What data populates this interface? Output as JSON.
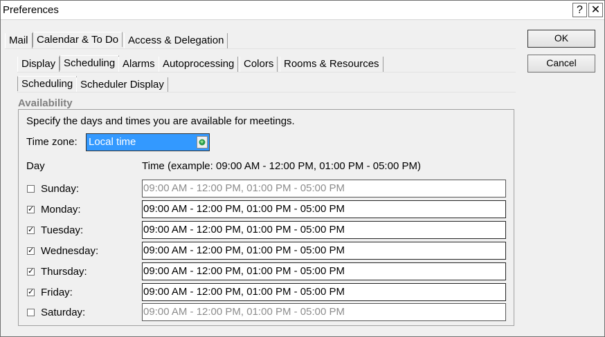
{
  "window": {
    "title": "Preferences",
    "help_glyph": "?",
    "close_glyph": "✕"
  },
  "tabs_main": [
    "Mail",
    "Calendar & To Do",
    "Access & Delegation"
  ],
  "tabs_calendar": [
    "Display",
    "Scheduling",
    "Alarms",
    "Autoprocessing",
    "Colors",
    "Rooms & Resources"
  ],
  "tabs_scheduling": [
    "Scheduling",
    "Scheduler Display"
  ],
  "buttons": {
    "ok": "OK",
    "cancel": "Cancel"
  },
  "availability": {
    "group_title": "Availability",
    "description": "Specify the days and times you are available for meetings.",
    "time_zone_label": "Time zone:",
    "time_zone_value": "Local time",
    "day_header": "Day",
    "time_header": "Time (example: 09:00 AM - 12:00 PM, 01:00 PM - 05:00 PM)",
    "days": [
      {
        "label": "Sunday:",
        "checked": false,
        "check_glyph": "",
        "value": "09:00 AM - 12:00 PM, 01:00 PM - 05:00 PM"
      },
      {
        "label": "Monday:",
        "checked": true,
        "check_glyph": "✓",
        "value": "09:00 AM - 12:00 PM, 01:00 PM - 05:00 PM"
      },
      {
        "label": "Tuesday:",
        "checked": true,
        "check_glyph": "✓",
        "value": "09:00 AM - 12:00 PM, 01:00 PM - 05:00 PM"
      },
      {
        "label": "Wednesday:",
        "checked": true,
        "check_glyph": "✓",
        "value": "09:00 AM - 12:00 PM, 01:00 PM - 05:00 PM"
      },
      {
        "label": "Thursday:",
        "checked": true,
        "check_glyph": "✓",
        "value": "09:00 AM - 12:00 PM, 01:00 PM - 05:00 PM"
      },
      {
        "label": "Friday:",
        "checked": true,
        "check_glyph": "✓",
        "value": "09:00 AM - 12:00 PM, 01:00 PM - 05:00 PM"
      },
      {
        "label": "Saturday:",
        "checked": false,
        "check_glyph": "",
        "value": "09:00 AM - 12:00 PM, 01:00 PM - 05:00 PM"
      }
    ]
  }
}
